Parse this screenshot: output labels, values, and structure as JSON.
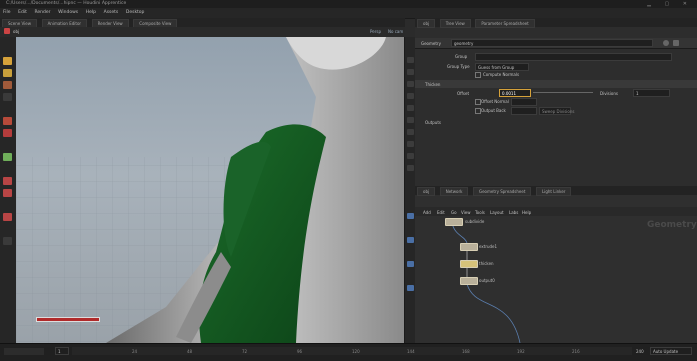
{
  "titlebar": {
    "text": "C:/Users/.../Documents/...hipnc — Houdini Apprentice"
  },
  "menu": {
    "items": [
      "File",
      "Edit",
      "Render",
      "Windows",
      "Help",
      "Assets",
      "Desktop"
    ]
  },
  "viewer": {
    "tabs": [
      "Scene View",
      "Animation Editor",
      "Render View",
      "Composite View"
    ],
    "path": "obj",
    "camera": "Persp",
    "view_menu": "No cam"
  },
  "params": {
    "tabs": [
      "obj",
      "Tree View",
      "Parameter Spreadsheet"
    ],
    "node_type": "Geometry",
    "node_name": "geometry",
    "group_label": "Group",
    "group_type_label": "Group Type",
    "group_type_value": "Guess from Group",
    "checkbox1": "Compute Normals",
    "section": "Thicken",
    "input_label": "Offset",
    "input_value": "0.0011",
    "divisions_label": "Divisions",
    "divisions_value": "1",
    "row_a": "Offset Normal",
    "row_b": "Output Back",
    "row_c": "Sweep Divisions",
    "sub_section": "Outputs"
  },
  "network": {
    "tabs": [
      "obj",
      "Network",
      "Geometry Spreadsheet",
      "Light Linker"
    ],
    "toolbar": [
      "Add",
      "Edit",
      "Go",
      "View",
      "Tools",
      "Layout",
      "Labs",
      "Help"
    ],
    "context_label": "Geometry",
    "nodes": [
      {
        "label": "subdivide"
      },
      {
        "label": "extrude1"
      },
      {
        "label": "thicken"
      },
      {
        "label": "output0"
      }
    ]
  },
  "timeline": {
    "frame": "1",
    "end_frame": "240",
    "ticks": [
      "24",
      "48",
      "72",
      "96",
      "120",
      "144",
      "168",
      "192",
      "216",
      "240"
    ],
    "controls": "Auto Update"
  },
  "colors": {
    "accent": "#d6a23a",
    "selection": "#1f6b2c",
    "panel": "#2d2d2d"
  }
}
